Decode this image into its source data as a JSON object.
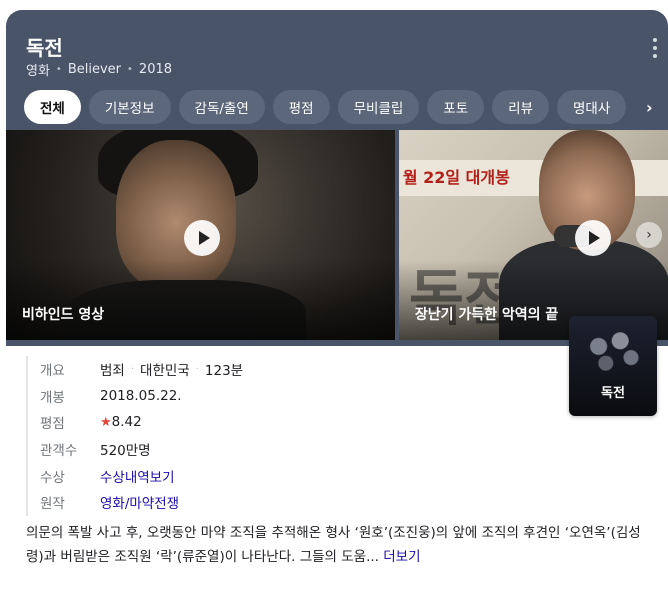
{
  "header": {
    "title": "독전",
    "subtitle": [
      "영화",
      "Believer",
      "2018"
    ]
  },
  "tabs": [
    {
      "label": "전체",
      "active": true
    },
    {
      "label": "기본정보"
    },
    {
      "label": "감독/출연"
    },
    {
      "label": "평점"
    },
    {
      "label": "무비클립"
    },
    {
      "label": "포토"
    },
    {
      "label": "리뷰"
    },
    {
      "label": "명대사"
    }
  ],
  "clips": [
    {
      "label": "비하인드 영상"
    },
    {
      "label": "장난기 가득한 악역의 끝",
      "banner": "월 22일 대개봉",
      "big_text": "독전"
    }
  ],
  "poster": {
    "title": "독전"
  },
  "info": {
    "overview_label": "개요",
    "overview": [
      "범죄",
      "대한민국",
      "123분"
    ],
    "release_label": "개봉",
    "release": "2018.05.22.",
    "rating_label": "평점",
    "rating": "8.42",
    "audience_label": "관객수",
    "audience": "520만명",
    "awards_label": "수상",
    "awards": "수상내역보기",
    "source_label": "원작",
    "source": "영화/마약전쟁"
  },
  "description": {
    "text": "의문의 폭발 사고 후, 오랫동안 마약 조직을 추적해온 형사 ‘원호’(조진웅)의 앞에 조직의 후견인 ‘오연옥’(김성령)과 버림받은 조직원 ‘락’(류준열)이 나타난다. 그들의 도움...",
    "more": "더보기"
  },
  "colors": {
    "header_bg": "#4a5468",
    "link": "#1a0dab",
    "star": "#e8453c"
  }
}
